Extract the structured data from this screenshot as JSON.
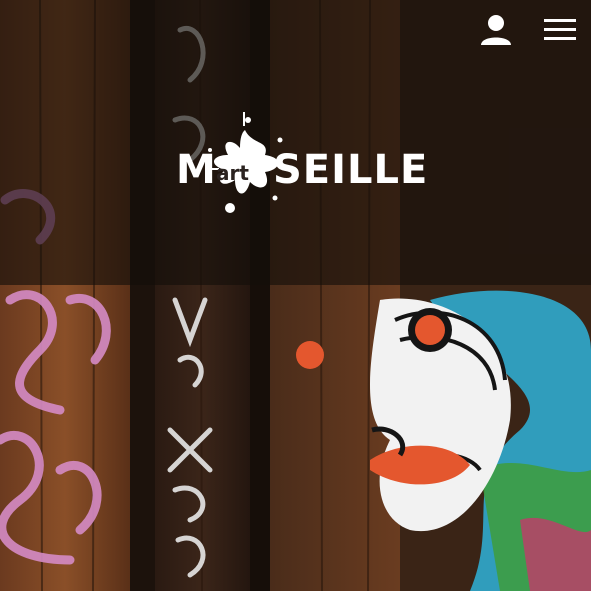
{
  "header": {
    "logo": {
      "prefix": "M",
      "inner": "art",
      "suffix": "SEILLE"
    },
    "actions": {
      "account_icon": "user-icon",
      "menu_icon": "hamburger-menu-icon"
    }
  },
  "colors": {
    "logo_text": "#ffffff",
    "overlay": "rgba(20,14,10,0.62)",
    "wood": "#3a2416",
    "graffiti_pink": "#d58bc5",
    "graffiti_orange": "#e4572e",
    "graffiti_cyan": "#2fb3d9"
  }
}
